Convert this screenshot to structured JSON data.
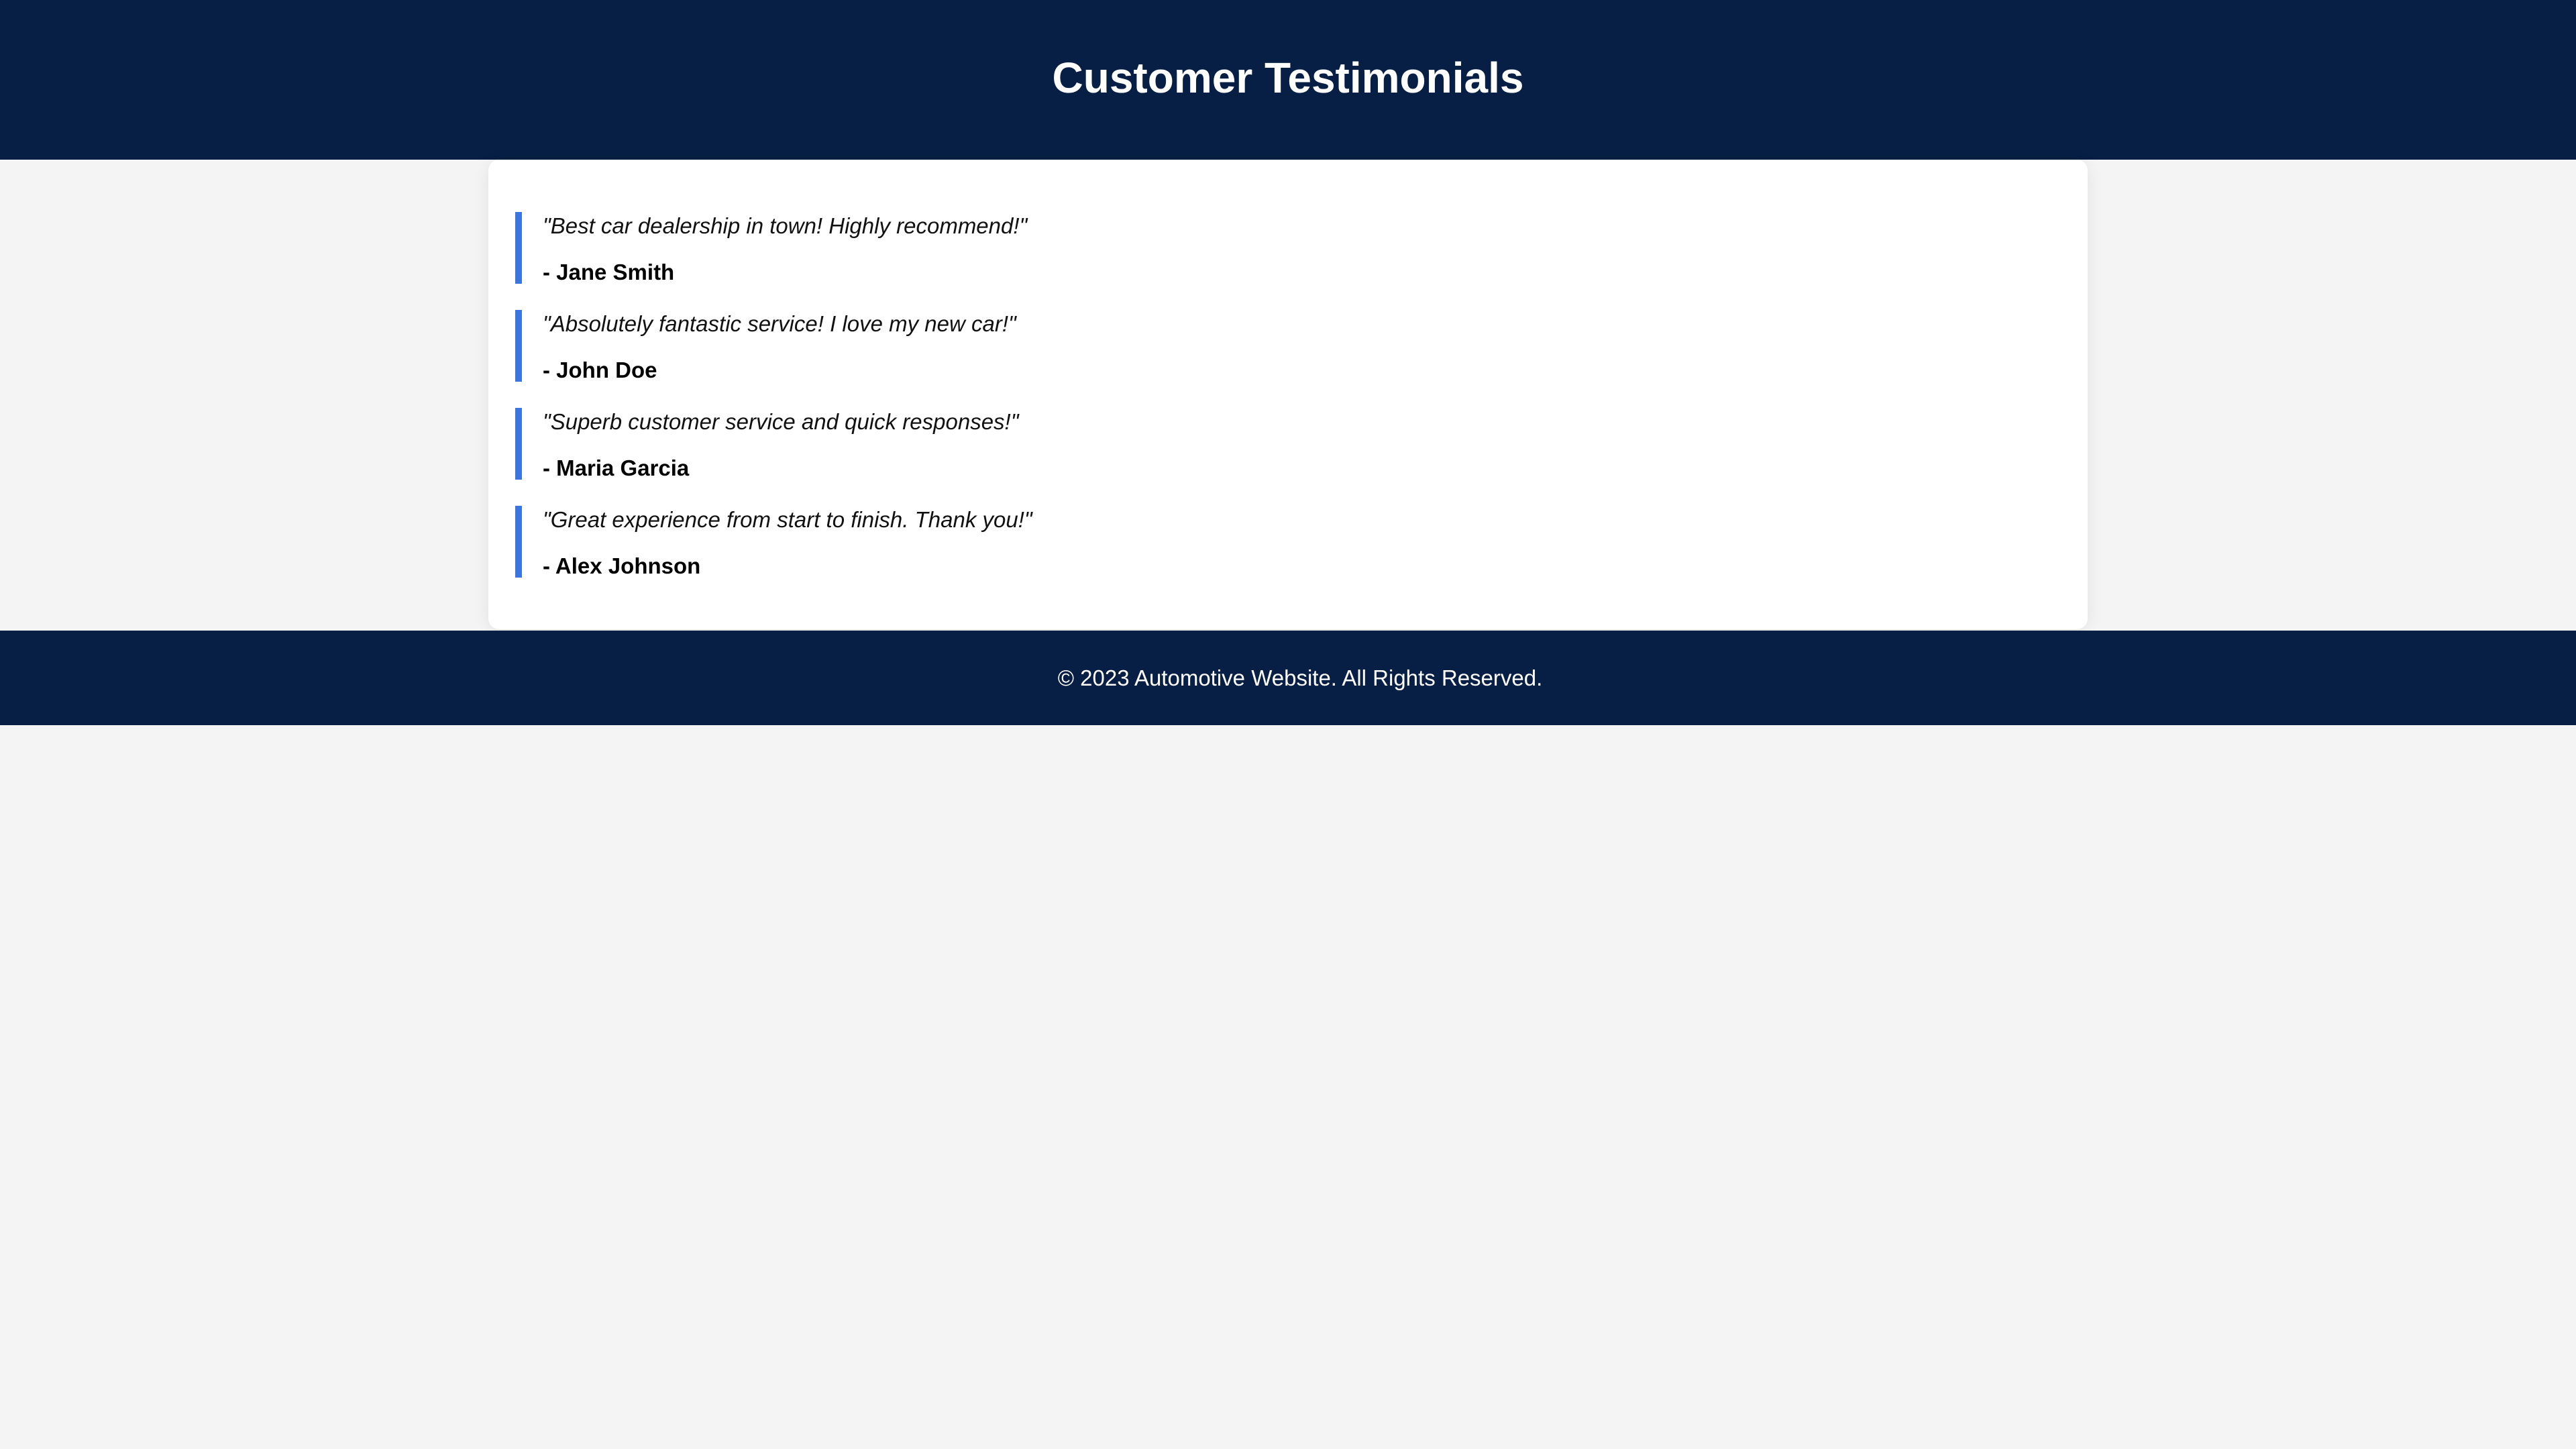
{
  "header": {
    "title": "Customer Testimonials"
  },
  "testimonials": [
    {
      "quote": "\"Best car dealership in town! Highly recommend!\"",
      "author": "- Jane Smith"
    },
    {
      "quote": "\"Absolutely fantastic service! I love my new car!\"",
      "author": "- John Doe"
    },
    {
      "quote": "\"Superb customer service and quick responses!\"",
      "author": "- Maria Garcia"
    },
    {
      "quote": "\"Great experience from start to finish. Thank you!\"",
      "author": "- Alex Johnson"
    }
  ],
  "footer": {
    "copyright": "© 2023 Automotive Website. All Rights Reserved."
  },
  "colors": {
    "header_bg": "#081f45",
    "accent": "#3a75e0",
    "page_bg": "#f4f4f4"
  }
}
